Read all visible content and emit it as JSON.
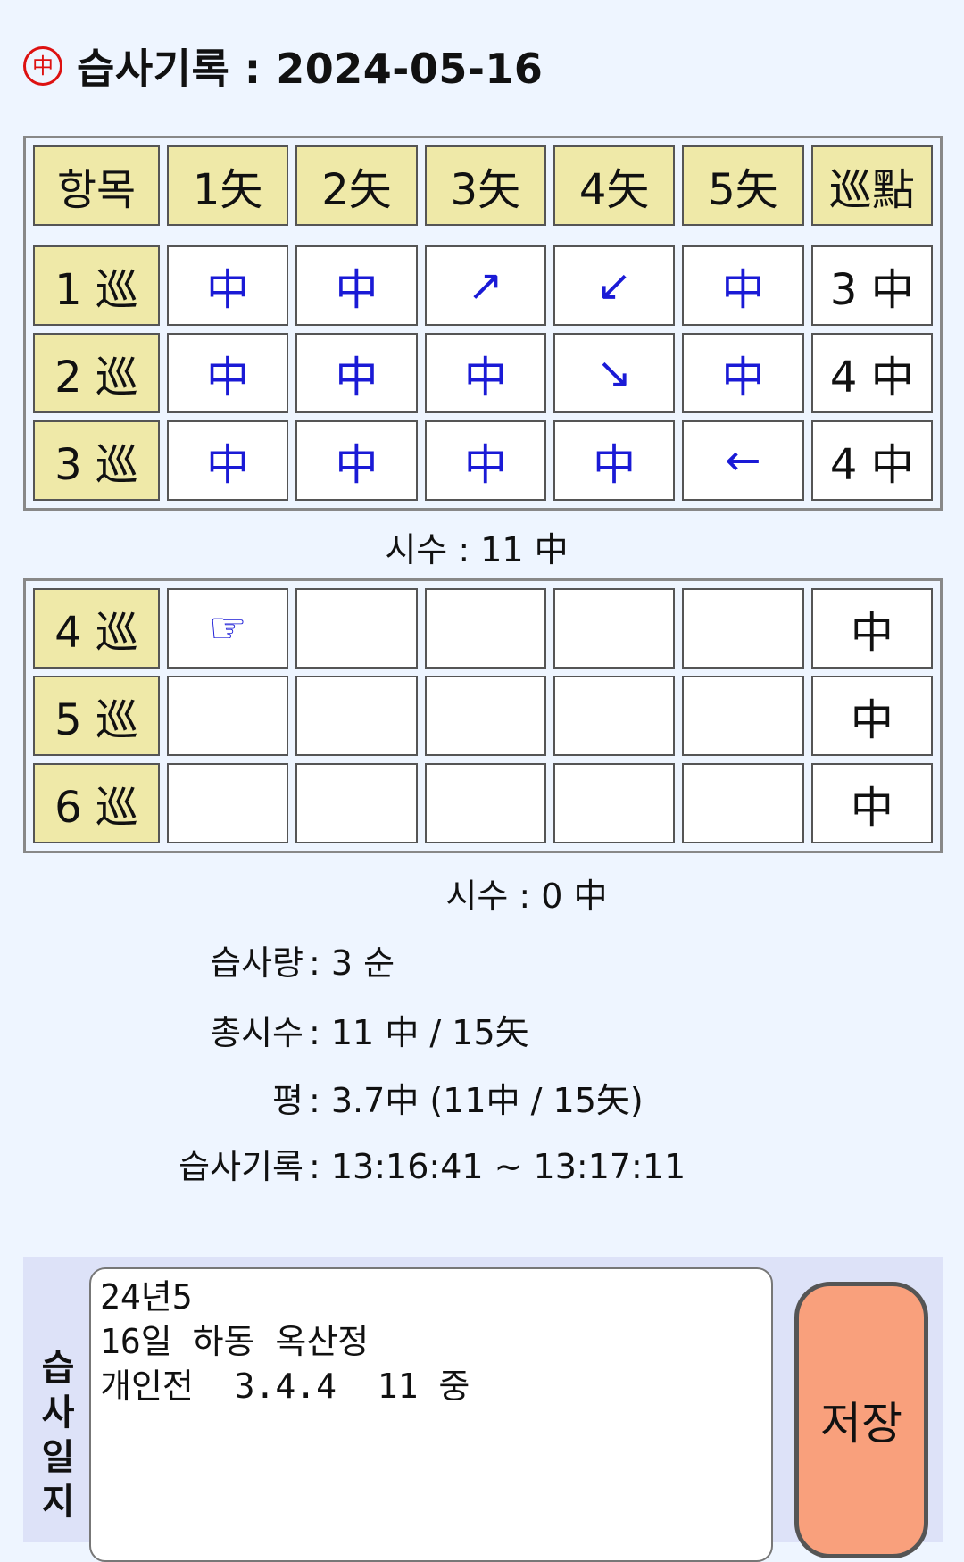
{
  "header": {
    "seal_icon": "中",
    "title": "습사기록 : 2024-05-16"
  },
  "table1": {
    "columns": [
      "항목",
      "1矢",
      "2矢",
      "3矢",
      "4矢",
      "5矢",
      "巡點"
    ],
    "rows": [
      {
        "label": "1 巡",
        "shots": [
          "中",
          "中",
          "↗",
          "↙",
          "中"
        ],
        "points": "3 中"
      },
      {
        "label": "2 巡",
        "shots": [
          "中",
          "中",
          "中",
          "↘",
          "中"
        ],
        "points": "4 中"
      },
      {
        "label": "3 巡",
        "shots": [
          "中",
          "中",
          "中",
          "中",
          "←"
        ],
        "points": "4 中"
      }
    ],
    "sisu": "시수 : 11 中"
  },
  "table2": {
    "rows": [
      {
        "label": "4 巡",
        "shots": [
          "☞",
          "",
          "",
          "",
          ""
        ],
        "points": "中"
      },
      {
        "label": "5 巡",
        "shots": [
          "",
          "",
          "",
          "",
          ""
        ],
        "points": "中"
      },
      {
        "label": "6 巡",
        "shots": [
          "",
          "",
          "",
          "",
          ""
        ],
        "points": "中"
      }
    ],
    "sisu": "시수 : 0 中"
  },
  "stats": [
    {
      "key": "습사량",
      "value": ": 3 순"
    },
    {
      "key": "총시수",
      "value": ": 11 中 / 15矢"
    },
    {
      "key": "평",
      "value": ": 3.7中 (11中 / 15矢)"
    },
    {
      "key": "습사기록",
      "value": ": 13:16:41 ~ 13:17:11"
    }
  ],
  "journal": {
    "label": "습사일지",
    "text": "24년5\n16일 하동 옥산정\n개인전  3.4.4  11 중",
    "save_label": "저장"
  },
  "colors": {
    "header_cell": "#efe9a8",
    "arrow": "#1a1ad6",
    "save_button": "#f9a07c",
    "background": "#eef5ff"
  }
}
